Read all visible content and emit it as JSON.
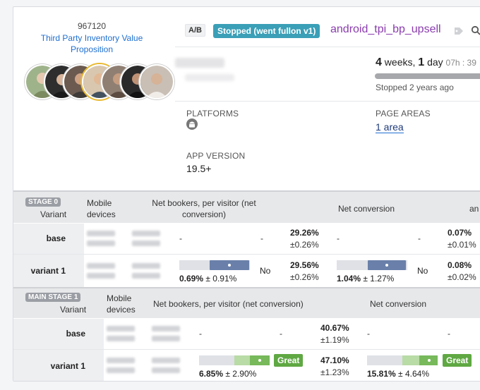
{
  "experiment": {
    "id": "967120",
    "title": "Third Party Inventory Value Proposition",
    "ab_label": "A/B",
    "status": "Stopped (went fullon v1)",
    "name": "android_tpi_bp_upsell"
  },
  "avatars": [
    {
      "name": "avatar-1",
      "color": "#8aa37a"
    },
    {
      "name": "avatar-2",
      "color": "#3b3b3b"
    },
    {
      "name": "avatar-3",
      "color": "#5a4a44"
    },
    {
      "name": "avatar-4",
      "color": "#caa88a"
    },
    {
      "name": "avatar-5",
      "color": "#6b5a50"
    },
    {
      "name": "avatar-6",
      "color": "#222222"
    },
    {
      "name": "avatar-7",
      "color": "#a79a90"
    }
  ],
  "duration": {
    "weeks_num": "4",
    "weeks_label": "weeks,",
    "days_num": "1",
    "days_label": "day",
    "extra": "07h : 39",
    "progress": 1.0,
    "stopped": "Stopped 2 years ago"
  },
  "labels": {
    "platforms": "PLATFORMS",
    "page_areas": "PAGE AREAS",
    "page_areas_value": "1 area",
    "app_version": "APP VERSION",
    "app_version_value": "19.5+"
  },
  "stage0": {
    "stage": "STAGE 0",
    "variant_hd": "Variant",
    "mobile_hd": "Mobile devices",
    "metric1_hd": "Net bookers, per visitor (net conversion)",
    "metric2_hd": "Net conversion",
    "metric3_hd": "an",
    "rows": [
      {
        "name": "base",
        "m1_dash_a": "-",
        "m1_dash_b": "-",
        "m1_val": "29.26%",
        "m1_pm": "±0.26%",
        "m2_dash_a": "-",
        "m2_dash_b": "-",
        "m3_val": "0.07%",
        "m3_pm": "±0.01%"
      },
      {
        "name": "variant 1",
        "ci1_val": "0.69%",
        "ci1_pm": "± 0.91%",
        "ci1_verdict": "No",
        "m1_val": "29.56%",
        "m1_pm": "±0.26%",
        "ci2_val": "1.04%",
        "ci2_pm": "± 1.27%",
        "ci2_verdict": "No",
        "m3_val": "0.08%",
        "m3_pm": "±0.02%"
      }
    ]
  },
  "stage1": {
    "stage": "MAIN STAGE 1",
    "variant_hd": "Variant",
    "mobile_hd": "Mobile devices",
    "metric1_hd": "Net bookers, per visitor (net conversion)",
    "metric2_hd": "Net conversion",
    "rows": [
      {
        "name": "base",
        "m1_dash_a": "-",
        "m1_dash_b": "-",
        "m1_val": "40.67%",
        "m1_pm": "±1.19%",
        "m2_dash_a": "-",
        "m2_dash_b": "-"
      },
      {
        "name": "variant 1",
        "ci1_val": "6.85%",
        "ci1_pm": "± 2.90%",
        "ci1_verdict": "Great",
        "m1_val": "47.10%",
        "m1_pm": "±1.23%",
        "ci2_val": "15.81%",
        "ci2_pm": "± 4.64%",
        "ci2_verdict": "Great"
      }
    ]
  }
}
